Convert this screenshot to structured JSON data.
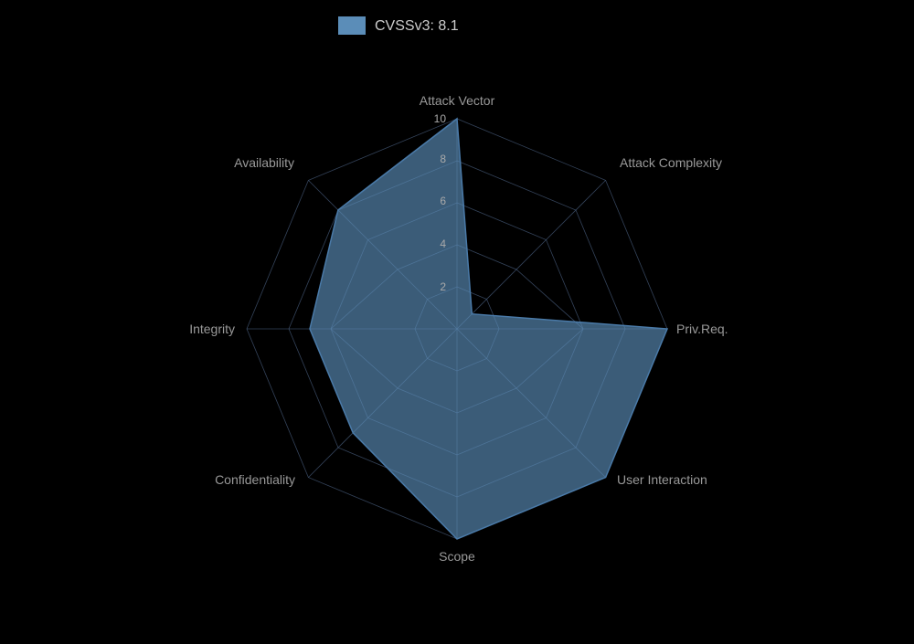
{
  "chart": {
    "title": "CVSSv3: 8.1",
    "legend_color": "#5b8db8",
    "axes": [
      {
        "label": "Attack Vector",
        "angle": -90,
        "value": 10
      },
      {
        "label": "Attack Complexity",
        "angle": -38.57,
        "value": 1
      },
      {
        "label": "Priv.Req.",
        "angle": 12.86,
        "value": 10
      },
      {
        "label": "User Interaction",
        "angle": 64.29,
        "value": 10
      },
      {
        "label": "Scope",
        "angle": 115.71,
        "value": 10
      },
      {
        "label": "Confidentiality",
        "angle": 167.14,
        "value": 7
      },
      {
        "label": "Integrity",
        "angle": 218.57,
        "value": 7
      },
      {
        "label": "Availability",
        "angle": 270,
        "value": 8
      }
    ],
    "grid_levels": [
      2,
      4,
      6,
      8,
      10
    ],
    "max_value": 10
  }
}
